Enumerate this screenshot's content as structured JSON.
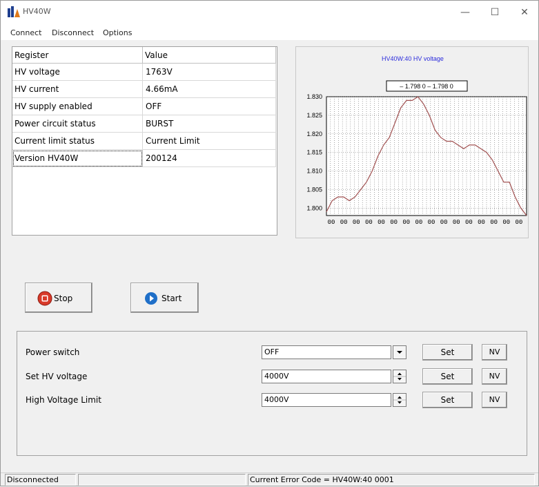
{
  "window": {
    "title": "HV40W",
    "minimize_glyph": "—",
    "maximize_glyph": "☐",
    "close_glyph": "✕"
  },
  "menu": {
    "items": [
      {
        "label": "Connect"
      },
      {
        "label": "Disconnect"
      },
      {
        "label": "Options"
      }
    ]
  },
  "register_table": {
    "headers": [
      "Register",
      "Value"
    ],
    "rows": [
      [
        "HV voltage",
        "1763V"
      ],
      [
        "HV current",
        "4.66mA"
      ],
      [
        "HV supply enabled",
        "OFF"
      ],
      [
        "Power circuit status",
        "BURST"
      ],
      [
        "Current limit status",
        "Current Limit"
      ],
      [
        "Version HV40W",
        "200124"
      ]
    ]
  },
  "chart_data": {
    "type": "line",
    "title": "HV40W:40 HV voltage",
    "legend_text": "– 1.798 0 – 1.798 0",
    "color": "#a05050",
    "title_color": "#2a2adc",
    "grid": true,
    "ylim": [
      1.798,
      1.83
    ],
    "yticks": [
      "1.830",
      "1.825",
      "1.820",
      "1.815",
      "1.810",
      "1.805",
      "1.800"
    ],
    "xtick_label": "00",
    "xtick_count": 16,
    "values": [
      1.799,
      1.802,
      1.803,
      1.803,
      1.802,
      1.803,
      1.805,
      1.807,
      1.81,
      1.814,
      1.817,
      1.819,
      1.823,
      1.827,
      1.829,
      1.829,
      1.83,
      1.828,
      1.825,
      1.821,
      1.819,
      1.818,
      1.818,
      1.817,
      1.816,
      1.817,
      1.817,
      1.816,
      1.815,
      1.813,
      1.81,
      1.807,
      1.807,
      1.803,
      1.8,
      1.798
    ]
  },
  "controls": {
    "stop_label": "Stop",
    "start_label": "Start",
    "power_switch": {
      "label": "Power switch",
      "value": "OFF"
    },
    "set_hv_voltage": {
      "label": "Set HV voltage",
      "value": "4000V"
    },
    "high_voltage_limit": {
      "label": "High Voltage Limit",
      "value": "4000V"
    },
    "set_label": "Set",
    "nv_label": "NV"
  },
  "status": {
    "connection": "Disconnected",
    "error": "Current Error Code = HV40W:40  0001"
  }
}
